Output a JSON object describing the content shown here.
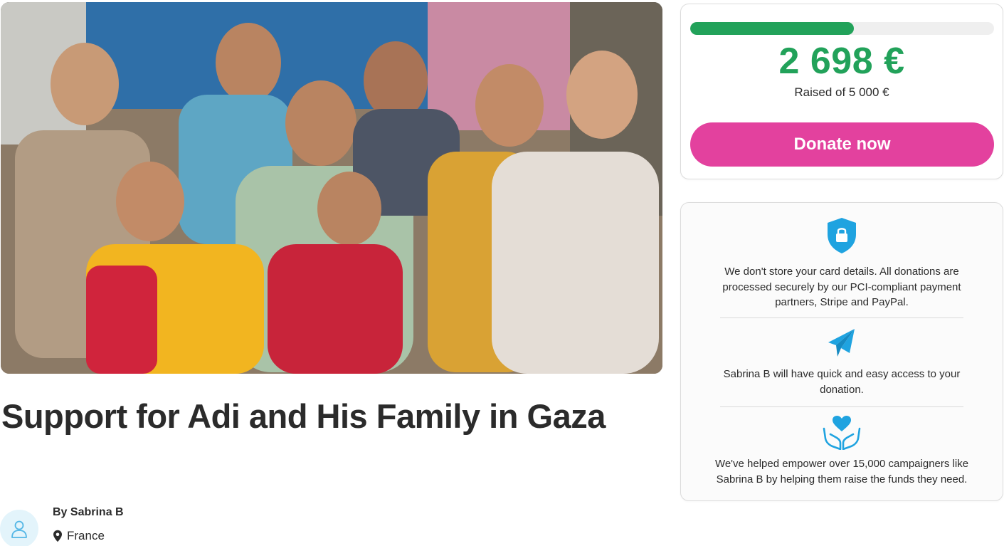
{
  "campaign": {
    "title": "Support for Adi and His Family in Gaza",
    "byline": "By Sabrina B",
    "location": "France",
    "photo_alt": "Campaign photo"
  },
  "donation": {
    "raised": "2 698 €",
    "goal_text": "Raised of 5 000 €",
    "progress_fraction": 0.5396,
    "button_label": "Donate now",
    "accent_color": "#22a25a",
    "button_color": "#e3419e"
  },
  "trust": {
    "items": [
      {
        "icon": "shield-lock-icon",
        "text": "We don't store your card details. All donations are processed securely by our PCI-compliant payment partners, Stripe and PayPal."
      },
      {
        "icon": "paper-plane-icon",
        "text": "Sabrina B will have quick and easy access to your donation."
      },
      {
        "icon": "heart-hands-icon",
        "text": "We've helped empower over 15,000 campaigners like Sabrina B by helping them raise the funds they need."
      }
    ],
    "icon_color": "#1fa3e0"
  }
}
